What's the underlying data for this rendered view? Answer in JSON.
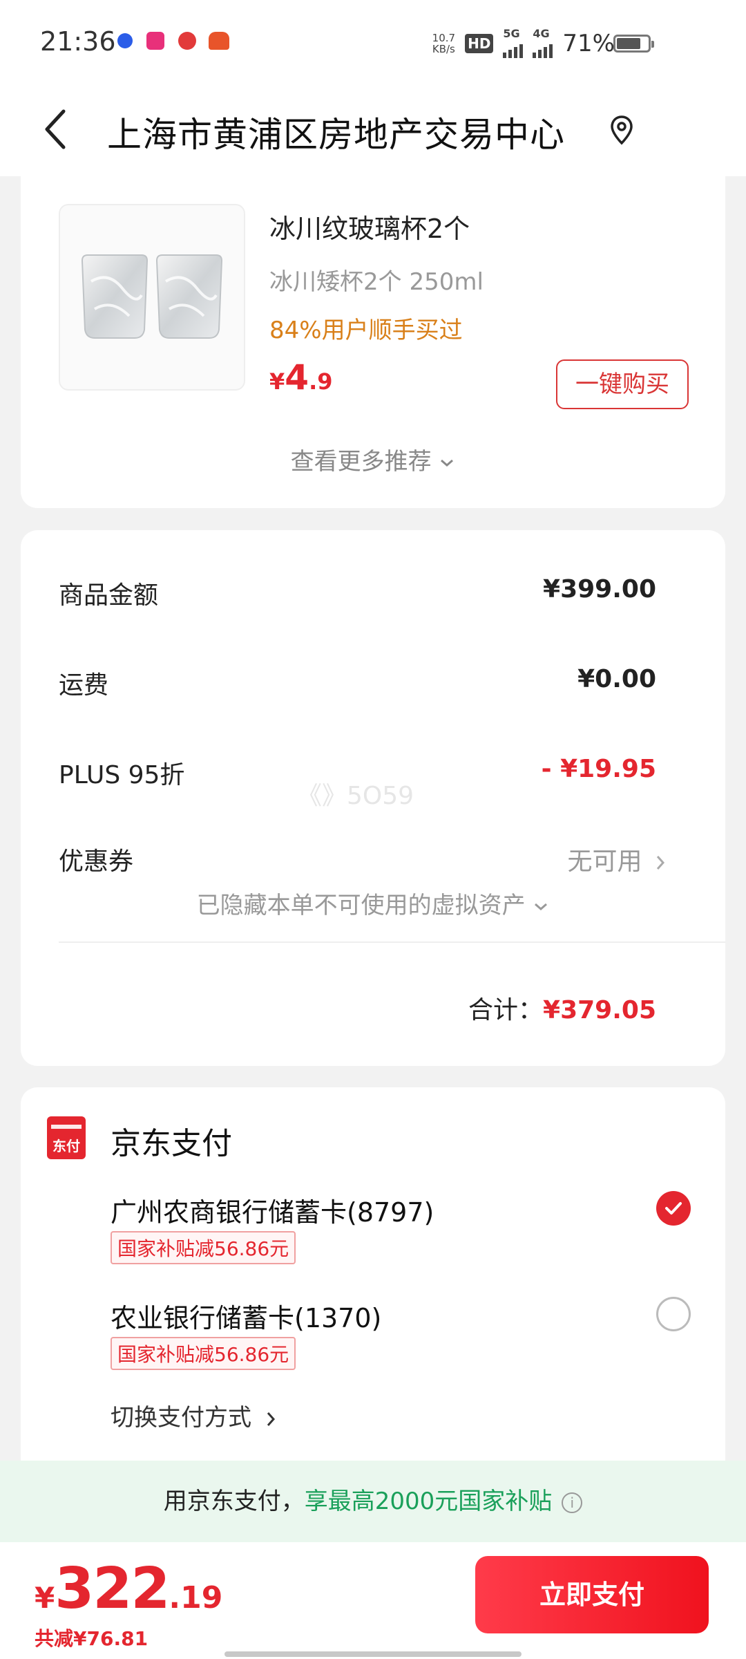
{
  "status_bar": {
    "time": "21:36",
    "network_speed_value": "10.7",
    "network_speed_unit": "KB/s",
    "hd_badge": "HD",
    "signal_1": "5G",
    "signal_2": "4G",
    "battery": "71%"
  },
  "header": {
    "back_icon": "chevron-left-icon",
    "title": "上海市黄浦区房地产交易中心",
    "location_icon": "location-pin-icon"
  },
  "recommendation": {
    "product": {
      "name": "冰川纹玻璃杯2个",
      "spec": "冰川矮杯2个 250ml",
      "hint": "84%用户顺手买过",
      "price_currency": "¥",
      "price_integer": "4",
      "price_decimal": ".9",
      "buy_label": "一键购买"
    },
    "more_label": "查看更多推荐"
  },
  "order_summary": {
    "rows": [
      {
        "label": "商品金额",
        "value": "¥399.00"
      },
      {
        "label": "运费",
        "value": "¥0.00"
      },
      {
        "label": "PLUS 95折",
        "value": "- ¥19.95"
      },
      {
        "label": "优惠券",
        "value": "无可用"
      }
    ],
    "hidden_assets_label": "已隐藏本单不可使用的虚拟资产",
    "watermark": "《》5O59",
    "total_label": "合计：",
    "total_value": "¥379.05"
  },
  "payment": {
    "icon_text": "东付",
    "title": "京东支付",
    "options": [
      {
        "name": "广州农商银行储蓄卡(8797)",
        "badge": "国家补贴减56.86元",
        "selected": true
      },
      {
        "name": "农业银行储蓄卡(1370)",
        "badge": "国家补贴减56.86元",
        "selected": false
      }
    ],
    "switch_label": "切换支付方式"
  },
  "promo": {
    "text_a": "用京东支付，",
    "text_b": "享最高2000元国家补贴",
    "info_icon": "ⓘ"
  },
  "footer": {
    "currency": "¥",
    "amount_integer": "322",
    "amount_decimal": ".19",
    "saving": "共减¥76.81",
    "pay_label": "立即支付"
  },
  "colors": {
    "accent_red": "#e4262f",
    "promo_green": "#1aa05a",
    "hint_orange": "#d9801a"
  }
}
